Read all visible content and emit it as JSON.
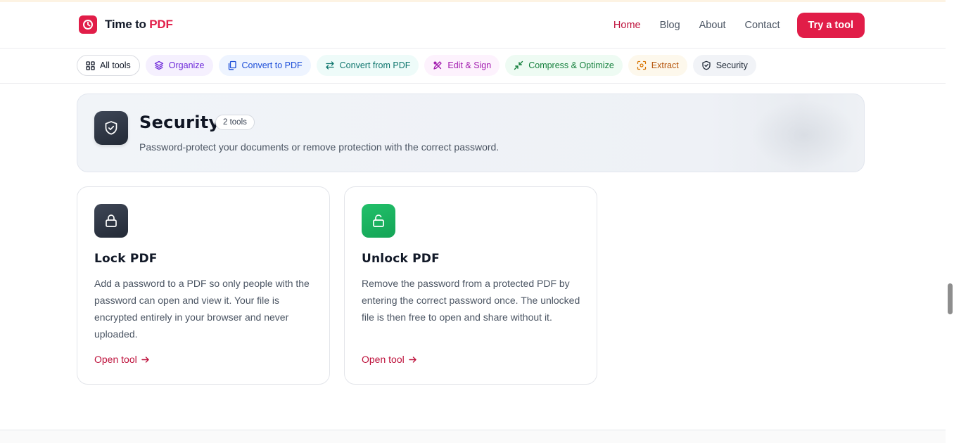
{
  "brand": {
    "name": "Time to ",
    "accent": "PDF",
    "color": "#e11d48"
  },
  "nav": {
    "items": [
      {
        "label": "Home",
        "active": true
      },
      {
        "label": "Blog",
        "active": false
      },
      {
        "label": "About",
        "active": false
      },
      {
        "label": "Contact",
        "active": false
      }
    ],
    "cta_label": "Try a tool"
  },
  "categories": [
    {
      "label": "All tools",
      "icon": "grid-icon"
    },
    {
      "label": "Organize",
      "icon": "layers-icon"
    },
    {
      "label": "Convert to PDF",
      "icon": "files-icon"
    },
    {
      "label": "Convert from PDF",
      "icon": "arrows-exchange-icon"
    },
    {
      "label": "Edit & Sign",
      "icon": "pen-tool-icon"
    },
    {
      "label": "Compress & Optimize",
      "icon": "shrink-arrows-icon"
    },
    {
      "label": "Extract",
      "icon": "scan-icon"
    },
    {
      "label": "Security",
      "icon": "shield-icon"
    }
  ],
  "section": {
    "title": "Security",
    "badge": "2 tools",
    "description": "Password-protect your documents or remove protection with the correct password.",
    "icon": "shield-check-icon"
  },
  "tools": [
    {
      "title": "Lock PDF",
      "description": "Add a password to a PDF so only people with the password can open and view it. Your file is encrypted entirely in your browser and never uploaded.",
      "link": "Open tool",
      "icon": "lock-icon",
      "icon_color": "#2b3240"
    },
    {
      "title": "Unlock PDF",
      "description": "Remove the password from a protected PDF by entering the correct password once. The unlocked file is then free to open and share without it.",
      "link": "Open tool",
      "icon": "unlock-icon",
      "icon_color": "#19b05f"
    }
  ]
}
